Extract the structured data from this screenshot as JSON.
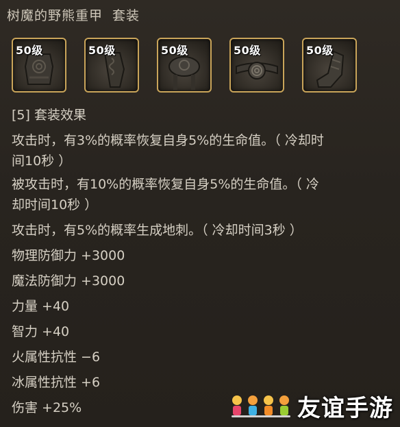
{
  "set": {
    "name": "树魔的野熊重甲",
    "suffix": "套装"
  },
  "slots": [
    {
      "level": "50级",
      "icon": "chest-armor-icon"
    },
    {
      "level": "50级",
      "icon": "leg-armor-icon"
    },
    {
      "level": "50级",
      "icon": "shoulder-armor-icon"
    },
    {
      "level": "50级",
      "icon": "belt-icon"
    },
    {
      "level": "50级",
      "icon": "boots-icon"
    }
  ],
  "effects": {
    "header": "[5] 套装效果",
    "line1a": "攻击时，有3%的概率恢复自身5%的生命值。（ 冷却时",
    "line1b": "间10秒 ）",
    "line2a": "被攻击时，有10%的概率恢复自身5%的生命值。（ 冷",
    "line2b": "却时间10秒 ）",
    "line3": "攻击时，有5%的概率生成地刺。（ 冷却时间3秒 ）"
  },
  "stats": [
    "物理防御力 +3000",
    "魔法防御力 +3000",
    "力量 +40",
    "智力 +40",
    "火属性抗性 −6",
    "冰属性抗性 +6",
    "伤害 +25%"
  ],
  "watermark": {
    "text": "友谊手游"
  },
  "colors": {
    "slot_border": "#caa55a",
    "text": "#d6d0c4"
  }
}
